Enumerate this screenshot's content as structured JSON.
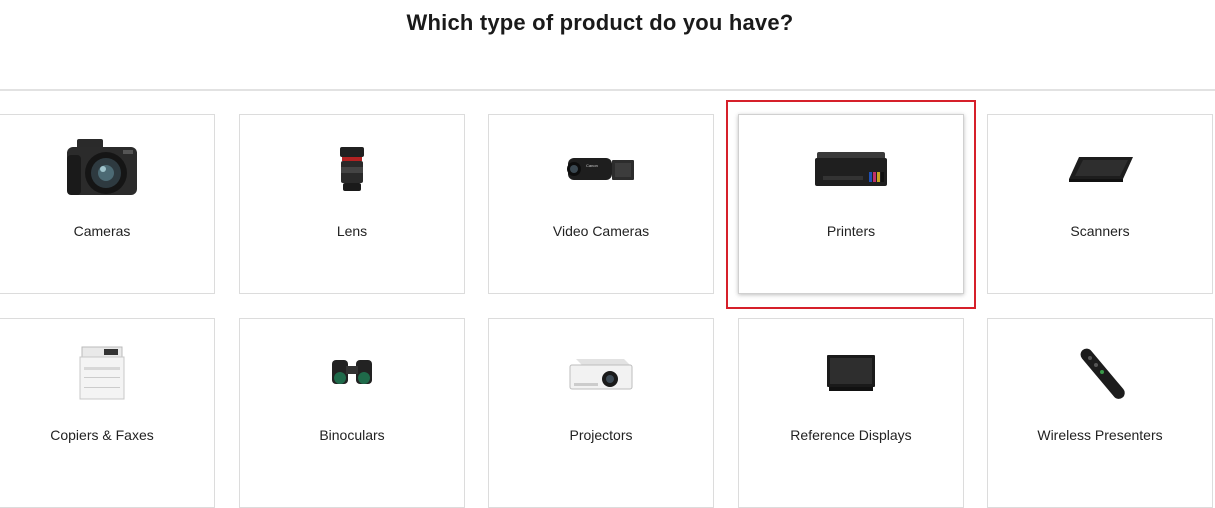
{
  "heading": "Which type of product do you have?",
  "highlight_color": "#d6202a",
  "selected_category": "Printers",
  "categories": [
    {
      "label": "Cameras",
      "icon": "camera-icon"
    },
    {
      "label": "Lens",
      "icon": "lens-icon"
    },
    {
      "label": "Video Cameras",
      "icon": "video-camera-icon"
    },
    {
      "label": "Printers",
      "icon": "printer-icon"
    },
    {
      "label": "Scanners",
      "icon": "scanner-icon"
    },
    {
      "label": "Copiers & Faxes",
      "icon": "copier-icon"
    },
    {
      "label": "Binoculars",
      "icon": "binoculars-icon"
    },
    {
      "label": "Projectors",
      "icon": "projector-icon"
    },
    {
      "label": "Reference Displays",
      "icon": "display-icon"
    },
    {
      "label": "Wireless Presenters",
      "icon": "presenter-icon"
    }
  ]
}
